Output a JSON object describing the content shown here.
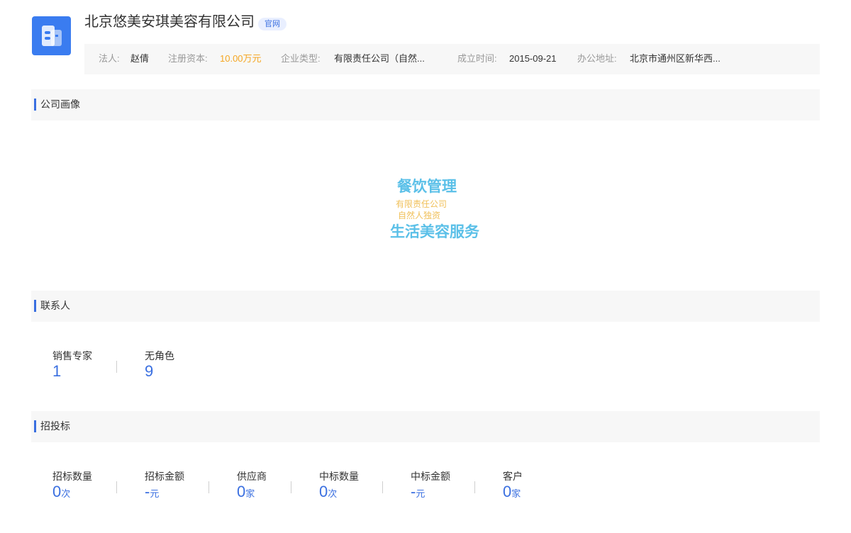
{
  "company": {
    "name": "北京悠美安琪美容有限公司",
    "official_tag": "官网",
    "colors": {
      "logo_bg": "#3a7cf0",
      "accent": "#3a6fe0",
      "capital": "#f5a623"
    }
  },
  "info": {
    "legal_person_label": "法人:",
    "legal_person": "赵倩",
    "capital_label": "注册资本:",
    "capital": "10.00万元",
    "type_label": "企业类型:",
    "type": "有限责任公司（自然...",
    "founded_label": "成立时间:",
    "founded": "2015-09-21",
    "address_label": "办公地址:",
    "address": "北京市通州区新华西..."
  },
  "portrait": {
    "title": "公司画像",
    "words": [
      {
        "text": "餐饮管理",
        "color": "#5bc0e8"
      },
      {
        "text": "有限责任公司",
        "color": "#f0c05a"
      },
      {
        "text": "自然人独资",
        "color": "#f0c05a"
      },
      {
        "text": "生活美容服务",
        "color": "#5bc0e8"
      }
    ]
  },
  "contacts": {
    "title": "联系人",
    "stats": [
      {
        "label": "销售专家",
        "value": "1"
      },
      {
        "label": "无角色",
        "value": "9"
      }
    ]
  },
  "bidding": {
    "title": "招投标",
    "stats": [
      {
        "label": "招标数量",
        "value": "0",
        "unit": "次"
      },
      {
        "label": "招标金额",
        "value": "-",
        "unit": "元"
      },
      {
        "label": "供应商",
        "value": "0",
        "unit": "家"
      },
      {
        "label": "中标数量",
        "value": "0",
        "unit": "次"
      },
      {
        "label": "中标金额",
        "value": "-",
        "unit": "元"
      },
      {
        "label": "客户",
        "value": "0",
        "unit": "家"
      }
    ]
  }
}
